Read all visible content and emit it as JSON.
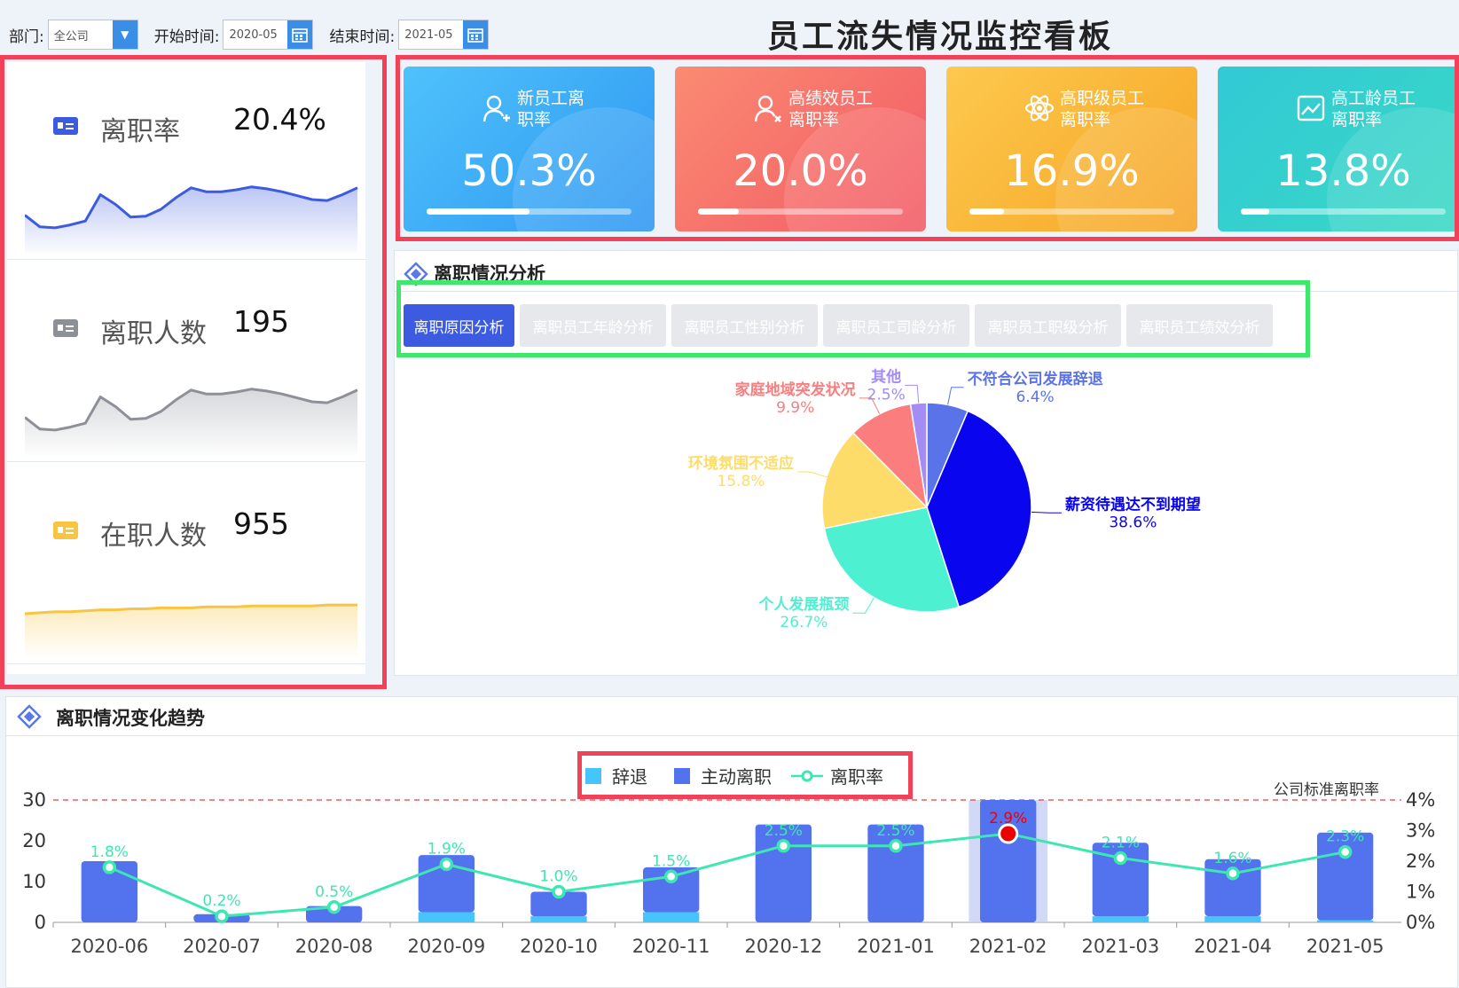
{
  "filters": {
    "dept_label": "部门:",
    "dept_value": "全公司",
    "start_label": "开始时间:",
    "start_value": "2020-05",
    "end_label": "结束时间:",
    "end_value": "2021-05"
  },
  "title": "员工流失情况监控看板",
  "left_kpis": [
    {
      "label": "离职率",
      "value": "20.4%",
      "color": "#3d5be0",
      "spark": [
        34,
        22,
        21,
        24,
        28,
        55,
        45,
        32,
        33,
        40,
        52,
        62,
        58,
        58,
        60,
        63,
        61,
        58,
        54,
        50,
        49,
        55,
        62
      ]
    },
    {
      "label": "离职人数",
      "value": "195",
      "color": "#8e9098",
      "spark": [
        34,
        22,
        21,
        24,
        28,
        55,
        45,
        32,
        33,
        40,
        52,
        62,
        58,
        58,
        60,
        63,
        61,
        58,
        54,
        50,
        49,
        55,
        62
      ]
    },
    {
      "label": "在职人数",
      "value": "955",
      "color": "#f7c542",
      "spark": [
        40,
        41,
        42,
        42,
        43,
        44,
        44,
        45,
        45,
        46,
        46,
        46,
        47,
        47,
        47,
        48,
        48,
        48,
        48,
        48,
        49,
        49,
        49
      ]
    }
  ],
  "cards": [
    {
      "title1": "新员工离",
      "title2": "职率",
      "value": "50.3%",
      "pct": 50.3,
      "c1": "#4fc2fb",
      "c2": "#2f97f2",
      "icon": "new-employee-icon"
    },
    {
      "title1": "高绩效员工",
      "title2": "离职率",
      "value": "20.0%",
      "pct": 20.0,
      "c1": "#fa8b72",
      "c2": "#f35a66",
      "icon": "high-performance-icon"
    },
    {
      "title1": "高职级员工",
      "title2": "离职率",
      "value": "16.9%",
      "pct": 16.9,
      "c1": "#fdc94e",
      "c2": "#f6a525",
      "icon": "atom-icon"
    },
    {
      "title1": "高工龄员工",
      "title2": "离职率",
      "value": "13.8%",
      "pct": 13.8,
      "c1": "#31c9d6",
      "c2": "#3ad9c4",
      "icon": "trend-image-icon"
    }
  ],
  "analysis": {
    "title": "离职情况分析",
    "tabs": [
      "离职原因分析",
      "离职员工年龄分析",
      "离职员工性别分析",
      "离职员工司龄分析",
      "离职员工职级分析",
      "离职员工绩效分析"
    ],
    "active_tab": 0
  },
  "chart_data": [
    {
      "type": "pie",
      "slices": [
        {
          "label": "不符合公司发展辞退",
          "value": 6.4,
          "pct": "6.4%",
          "color": "#5b73e8"
        },
        {
          "label": "薪资待遇达不到期望",
          "value": 38.6,
          "pct": "38.6%",
          "color": "#0a05ef"
        },
        {
          "label": "个人发展瓶颈",
          "value": 26.7,
          "pct": "26.7%",
          "color": "#4ef0d2"
        },
        {
          "label": "环境氛围不适应",
          "value": 15.8,
          "pct": "15.8%",
          "color": "#fddc6a"
        },
        {
          "label": "家庭地域突发状况",
          "value": 9.9,
          "pct": "9.9%",
          "color": "#fb7d7d"
        },
        {
          "label": "其他",
          "value": 2.5,
          "pct": "2.5%",
          "color": "#a38cf3"
        }
      ]
    },
    {
      "type": "bar",
      "categories": [
        "2020-06",
        "2020-07",
        "2020-08",
        "2020-09",
        "2020-10",
        "2020-11",
        "2020-12",
        "2021-01",
        "2021-02",
        "2021-03",
        "2021-04",
        "2021-05"
      ],
      "series": [
        {
          "name": "辞退",
          "values": [
            0,
            0,
            0,
            2.5,
            1.5,
            2.5,
            0,
            0,
            0,
            1.5,
            1.5,
            0.5
          ],
          "color": "#46c5fb"
        },
        {
          "name": "主动离职",
          "values": [
            15,
            2,
            4,
            14,
            6,
            11,
            24,
            24,
            30,
            18,
            14,
            21.5
          ],
          "color": "#5372ee"
        },
        {
          "name": "离职率",
          "values": [
            1.8,
            0.2,
            0.5,
            1.9,
            1.0,
            1.5,
            2.5,
            2.5,
            2.9,
            2.1,
            1.6,
            2.3
          ],
          "labels": [
            "1.8%",
            "0.2%",
            "0.5%",
            "1.9%",
            "1.0%",
            "1.5%",
            "2.5%",
            "2.5%",
            "2.9%",
            "2.1%",
            "1.6%",
            "2.3%"
          ],
          "color": "#3ee6b2"
        }
      ],
      "yLeft": {
        "ticks": [
          "30",
          "20",
          "10",
          "0"
        ],
        "max": 30
      },
      "yRight": {
        "ticks": [
          "4%",
          "3%",
          "2%",
          "1%",
          "0%"
        ],
        "max": 4
      },
      "reference_label": "公司标准离职率",
      "reference_value": 4,
      "highlight_index": 8,
      "title": "离职情况变化趋势"
    }
  ]
}
